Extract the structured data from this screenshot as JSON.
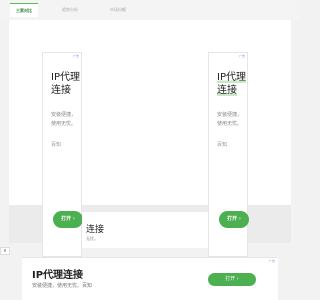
{
  "tabs": [
    {
      "label": "三家对比"
    },
    {
      "label": "趋势分析"
    },
    {
      "label": "市场份额"
    }
  ],
  "ad": {
    "badge": "广告",
    "title_line1": "IP代理",
    "title_line2": "连接",
    "desc_line1": "安装便捷，",
    "desc_line2": "使用无忧。",
    "brand": "百知",
    "button": "打开 ›"
  },
  "mid_card": {
    "fragment": "连接",
    "fragment2": "无忧。"
  },
  "collapse_icon": "∨",
  "banner": {
    "badge": "广告",
    "title": "IP代理连接",
    "desc": "安装便捷，使用无忧。百知",
    "button": "打开 ›"
  },
  "colors": {
    "accent": "#4caf50",
    "highlight": "#c9e8c6"
  }
}
